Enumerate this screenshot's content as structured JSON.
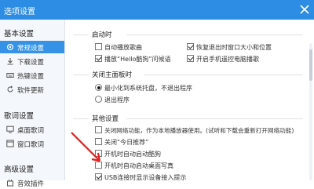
{
  "window": {
    "title": "选项设置"
  },
  "sidebar": {
    "basic": {
      "header": "基本设置",
      "items": [
        {
          "label": "常规设置",
          "icon": "gear-icon",
          "active": true
        },
        {
          "label": "下载设置",
          "icon": "download-icon"
        },
        {
          "label": "热键设置",
          "icon": "keyboard-icon"
        },
        {
          "label": "软件更新",
          "icon": "update-icon"
        }
      ]
    },
    "lyrics": {
      "header": "歌词设置",
      "items": [
        {
          "label": "桌面歌词",
          "icon": "desktop-lyrics-icon"
        },
        {
          "label": "窗口歌词",
          "icon": "window-lyrics-icon"
        }
      ]
    },
    "advanced": {
      "header": "高级设置",
      "items": [
        {
          "label": "音效插件",
          "icon": "plugin-icon"
        }
      ]
    }
  },
  "main": {
    "startup": {
      "title": "启动时",
      "options": [
        {
          "label": "自动播放歌曲",
          "checked": false
        },
        {
          "label": "恢复退出时窗口大小和位置",
          "checked": true
        },
        {
          "label": "播放“Hello酷狗”问候语",
          "checked": true
        },
        {
          "label": "开启手机遥控电脑播歌",
          "checked": true
        }
      ]
    },
    "close_panel": {
      "title": "关闭主面板时",
      "options": [
        {
          "label": "最小化到系统托盘，不退出程序",
          "selected": true
        },
        {
          "label": "退出程序",
          "selected": false
        }
      ]
    },
    "other": {
      "title": "其他设置",
      "options": [
        {
          "label": "关闭网络功能，作为本地播放器使用。(试听和下载会重新打开网络功能)",
          "checked": false
        },
        {
          "label": "关闭“今日推荐”",
          "checked": false
        },
        {
          "label": "开机时自动启动酷狗",
          "checked": false
        },
        {
          "label": "开机时自动启动桌面写真",
          "checked": false
        },
        {
          "label": "USB连接时显示设备接入提示",
          "checked": true
        }
      ]
    }
  },
  "colors": {
    "titlebar": "#2d8ce3",
    "active_item": "#3592e6",
    "annotation_arrow": "#e02020"
  }
}
